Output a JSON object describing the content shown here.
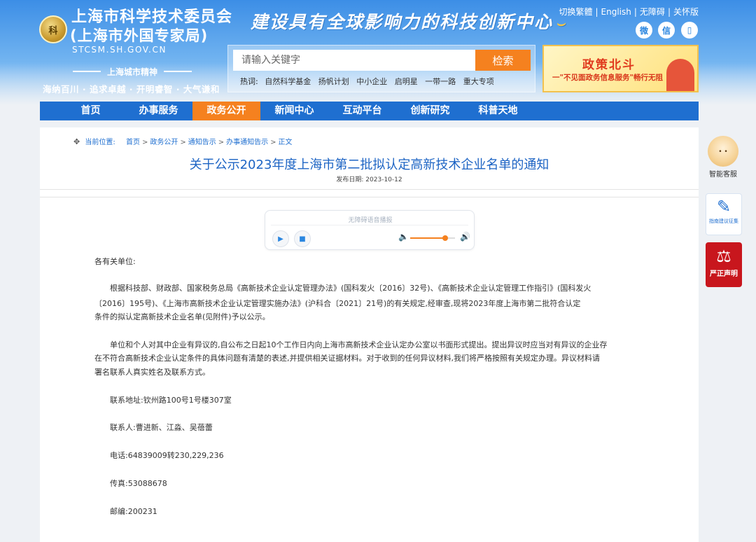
{
  "header": {
    "title_line1": "上海市科学技术委员会",
    "title_line2": "(上海市外国专家局)",
    "domain": "STCSM.SH.GOV.CN",
    "logo_text": "科",
    "spirit_title": "上海城市精神",
    "spirit_motto": "海纳百川 · 追求卓越 · 开明睿智 · 大气谦和",
    "slogan": "建设具有全球影响力的科技创新中心"
  },
  "top_links": [
    "切换繁體",
    "English",
    "无障碍",
    "关怀版"
  ],
  "social_icons": [
    {
      "name": "weibo-icon",
      "glyph": "微"
    },
    {
      "name": "wechat-icon",
      "glyph": "信"
    },
    {
      "name": "mobile-icon",
      "glyph": "▯"
    }
  ],
  "search": {
    "placeholder": "请输入关键字",
    "button_label": "检索",
    "hot_label": "热词:",
    "hot_words": [
      "自然科学基金",
      "扬帆计划",
      "中小企业",
      "启明星",
      "一带一路",
      "重大专项"
    ]
  },
  "banner": {
    "title": "政策北斗",
    "subtitle": "一\"不见面政务信息服务\"畅行无阻"
  },
  "nav": {
    "items": [
      "首页",
      "办事服务",
      "政务公开",
      "新闻中心",
      "互动平台",
      "创新研究",
      "科普天地"
    ],
    "active_index": 2
  },
  "breadcrumb": {
    "label": "当前位置:",
    "items": [
      "首页",
      "政务公开",
      "通知告示",
      "办事通知告示",
      "正文"
    ]
  },
  "article": {
    "title": "关于公示2023年度上海市第二批拟认定高新技术企业名单的通知",
    "date_label": "发布日期:",
    "date": "2023-10-12",
    "greeting": "各有关单位:",
    "para1_lines": [
      "根据科技部、财政部、国家税务总局《高新技术企业认定管理办法》(国科发火〔2016〕32号)、《高新技术企业认定管理工作指引》(国科发火",
      "〔2016〕195号)、《上海市高新技术企业认定管理实施办法》(沪科合〔2021〕21号)的有关规定,经审查,现将2023年度上海市第二批符合认定",
      "条件的拟认定高新技术企业名单(见附件)予以公示。"
    ],
    "para2_lines": [
      "单位和个人对其中企业有异议的,自公布之日起10个工作日内向上海市高新技术企业认定办公室以书面形式提出。提出异议时应当对有异议的企业存",
      "在不符合高新技术企业认定条件的具体问题有清楚的表述,并提供相关证据材料。对于收到的任何异议材料,我们将严格按照有关规定办理。异议材料请",
      "署名联系人真实姓名及联系方式。"
    ],
    "address": "联系地址:钦州路100号1号楼307室",
    "contacts": "联系人:曹进新、江淼、吴蓓蕾",
    "phone": "电话:64839009转230,229,236",
    "fax": "传真:53088678",
    "postcode": "邮编:200231"
  },
  "audio": {
    "label": "无障碍语音播报",
    "volume": 0.78
  },
  "side_widgets": {
    "kefu_label": "智能客服",
    "jianyi_label": "指南建议征集",
    "shengming_label": "严正声明"
  },
  "colors": {
    "primary": "#1f6fd0",
    "accent": "#f5811f",
    "alert": "#c8161d"
  }
}
